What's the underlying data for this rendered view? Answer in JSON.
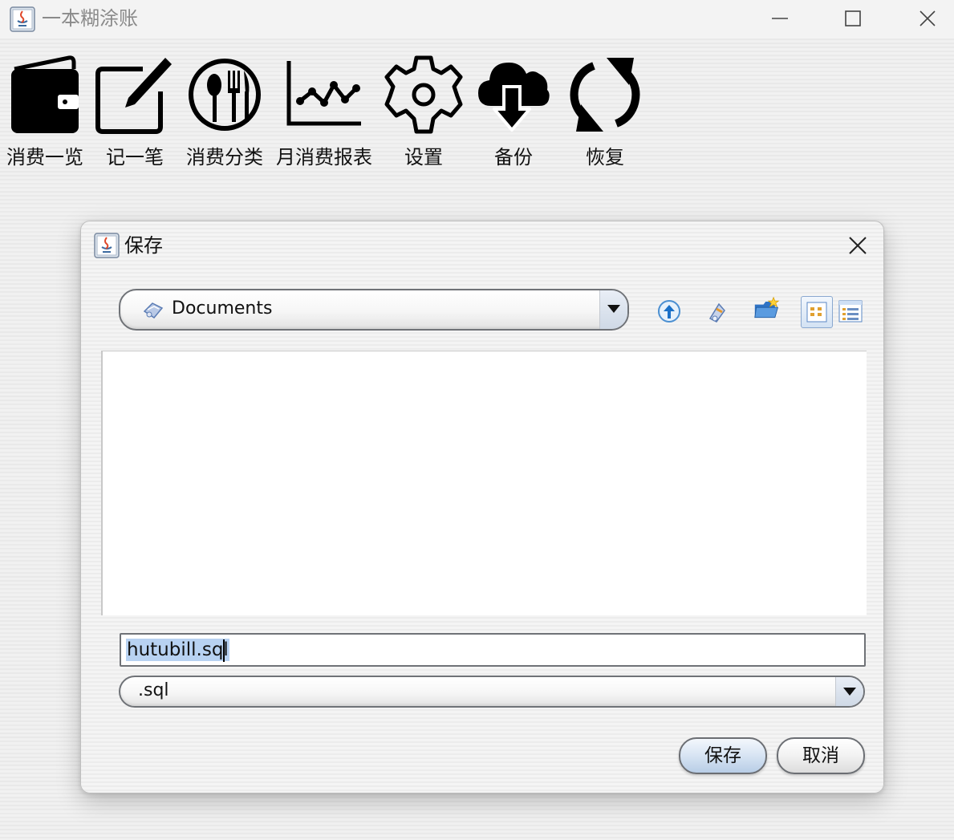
{
  "window": {
    "title": "一本糊涂账"
  },
  "toolbar": {
    "items": [
      {
        "label": "消费一览",
        "icon": "wallet-icon"
      },
      {
        "label": "记一笔",
        "icon": "edit-icon"
      },
      {
        "label": "消费分类",
        "icon": "dining-icon"
      },
      {
        "label": "月消费报表",
        "icon": "line-chart-icon"
      },
      {
        "label": "设置",
        "icon": "gear-icon"
      },
      {
        "label": "备份",
        "icon": "cloud-download-icon"
      },
      {
        "label": "恢复",
        "icon": "refresh-icon"
      }
    ]
  },
  "dialog": {
    "title": "保存",
    "look_in": "Documents",
    "filename": "hutubill.sql",
    "file_type": ".sql",
    "save_label": "保存",
    "cancel_label": "取消"
  },
  "colors": {
    "selection": "#b8d2f2",
    "title_text": "#8a8a8a"
  }
}
